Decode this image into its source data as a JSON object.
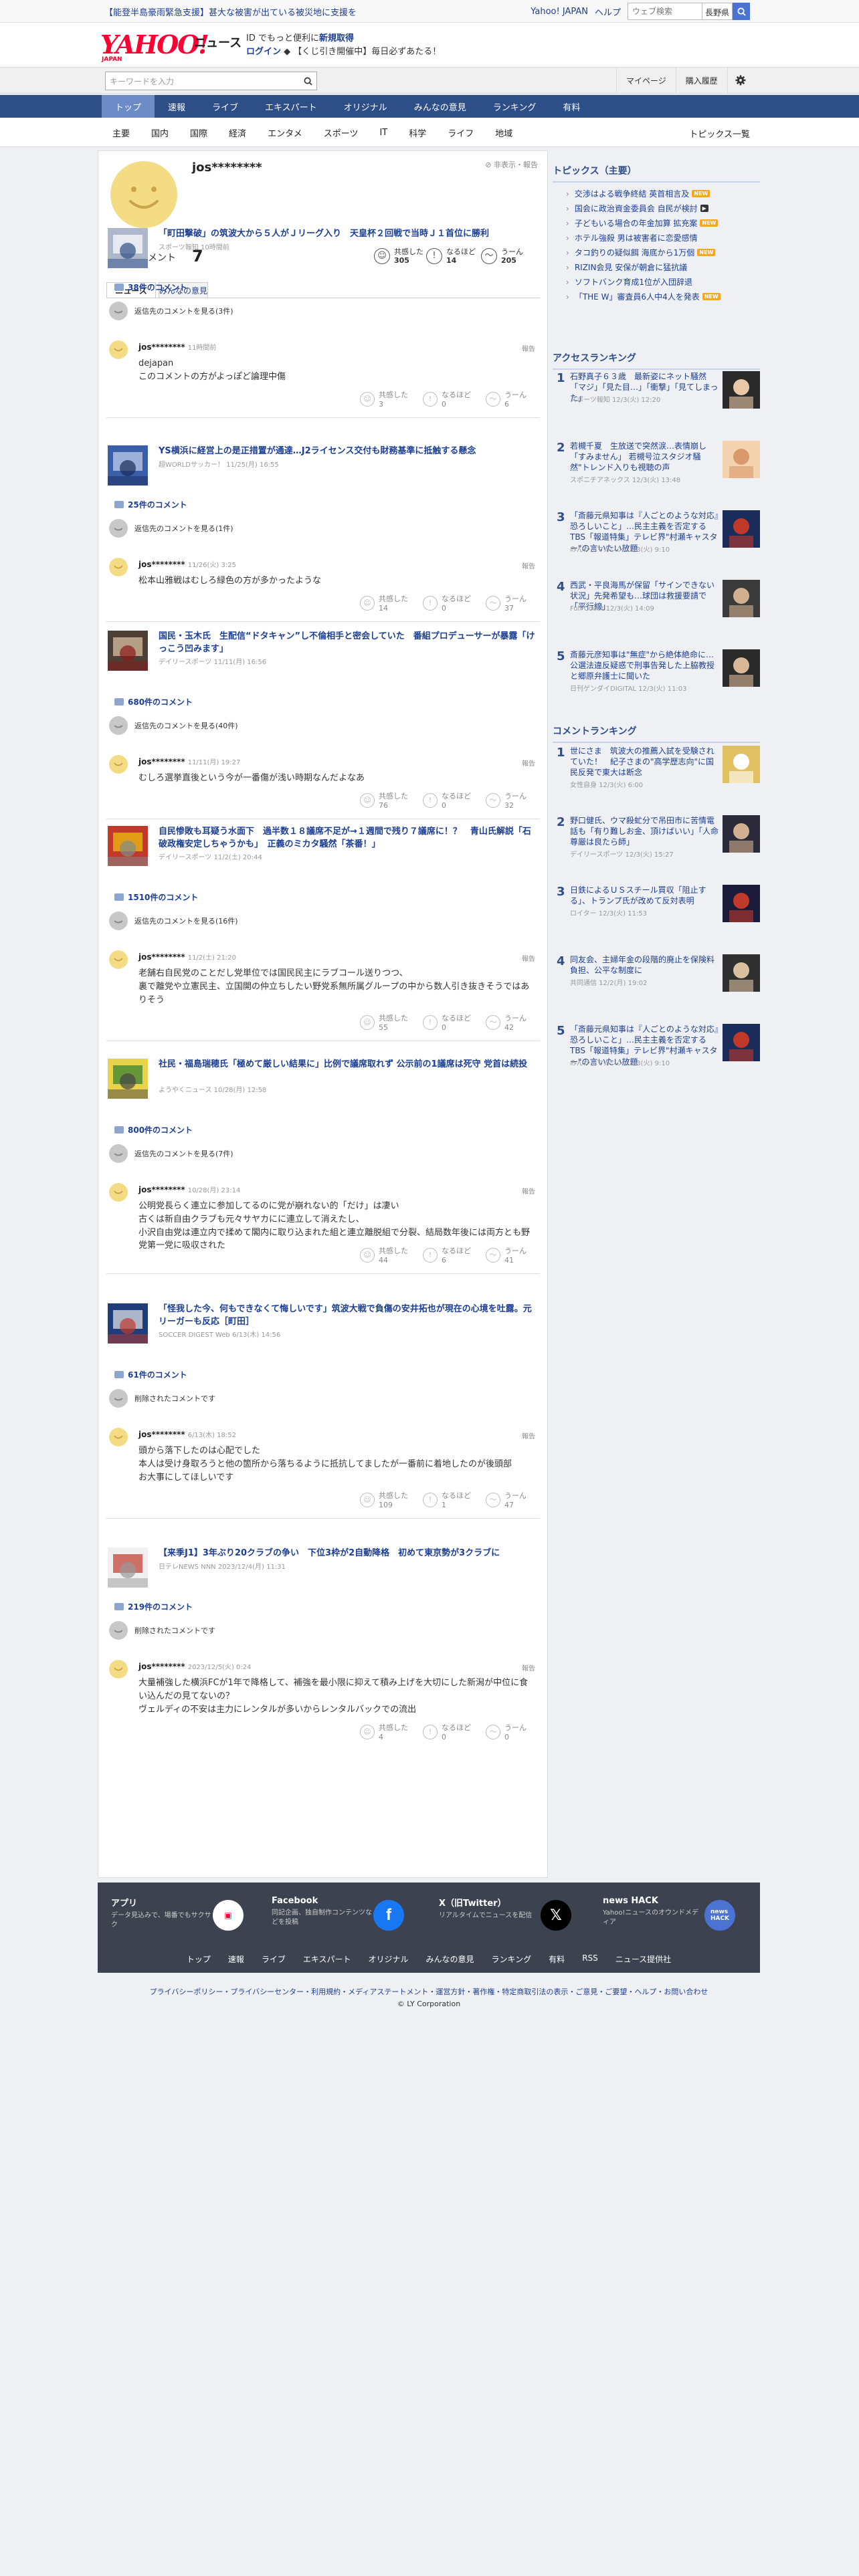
{
  "alert_bar": {
    "text": "【能登半島豪雨緊急支援】甚大な被害が出ている被災地に支援を",
    "yahoo_japan": "Yahoo! JAPAN",
    "help": "ヘルプ",
    "search_placeholder": "ウェブ検索",
    "location": "長野県"
  },
  "header": {
    "logo": "YAHOO!",
    "logo_sub": "JAPAN",
    "news": "ニュース",
    "msg_line1_pre": "ID でもっと便利に",
    "msg_line1_link": "新規取得",
    "msg_line2_login": "ログイン",
    "msg_line2_text": "【くじ引き開催中】毎日必ずあたる！"
  },
  "search": {
    "placeholder": "キーワードを入力",
    "mypage": "マイページ",
    "purchase": "購入履歴"
  },
  "global_nav": [
    "トップ",
    "速報",
    "ライブ",
    "エキスパート",
    "オリジナル",
    "みんなの意見",
    "ランキング",
    "有料"
  ],
  "sub_nav": [
    "主要",
    "国内",
    "国際",
    "経済",
    "エンタメ",
    "スポーツ",
    "IT",
    "科学",
    "ライフ",
    "地域"
  ],
  "topics_link": "トピックス一覧",
  "profile": {
    "name": "jos********",
    "report": "非表示・報告",
    "count_label": "投稿コメント",
    "count": "7",
    "reactions": [
      {
        "label": "共感した",
        "value": "305"
      },
      {
        "label": "なるほど",
        "value": "14"
      },
      {
        "label": "うーん",
        "value": "205"
      }
    ]
  },
  "tabs": [
    "ニュース",
    "みんなの意見"
  ],
  "entries": [
    {
      "title": "「町田撃破」の筑波大から５人がＪリーグ入り　天皇杯２回戦で当時Ｊ１首位に勝利",
      "meta": "スポーツ報知 10時間前",
      "count": "38件のコメント",
      "more": "返信先のコメントを見る(3件)",
      "user": "jos********",
      "time": "11時間前",
      "report": "報告",
      "text": "dejapan\nこのコメントの方がよっぽど論理中傷",
      "r": [
        "共感した",
        "3",
        "なるほど",
        "0",
        "うーん",
        "6"
      ]
    },
    {
      "title": "YS横浜に経営上の是正措置が通達…J2ライセンス交付も財務基準に抵触する懸念",
      "meta": "超WORLDサッカー！ 11/25(月) 16:55",
      "count": "25件のコメント",
      "more": "返信先のコメントを見る(1件)",
      "user": "jos********",
      "time": "11/26(火) 3:25",
      "report": "報告",
      "text": "松本山雅戦はむしろ緑色の方が多かったような",
      "r": [
        "共感した",
        "14",
        "なるほど",
        "0",
        "うーん",
        "37"
      ]
    },
    {
      "title": "国民・玉木氏　生配信“ドタキャン”し不倫相手と密会していた　番組プロデューサーが暴露「けっこう凹みます」",
      "meta": "デイリースポーツ 11/11(月) 16:56",
      "count": "680件のコメント",
      "more": "返信先のコメントを見る(40件)",
      "user": "jos********",
      "time": "11/11(月) 19:27",
      "report": "報告",
      "text": "むしろ選挙直後という今が一番傷が浅い時期なんだよなあ",
      "r": [
        "共感した",
        "76",
        "なるほど",
        "0",
        "うーん",
        "32"
      ]
    },
    {
      "title": "自民惨敗も耳疑う水面下　過半数１８議席不足が→１週間で残り７議席に！？　青山氏解説「石破政権安定しちゃうかも」　正義のミカタ騒然「茶番！」",
      "meta": "デイリースポーツ 11/2(土) 20:44",
      "count": "1510件のコメント",
      "more": "返信先のコメントを見る(16件)",
      "user": "jos********",
      "time": "11/2(土) 21:20",
      "report": "報告",
      "text": "老舗右自民党のことだし党単位では国民民主にラブコール送りつつ、\n裏で離党や立憲民主、立国開の仲立ちしたい野党系無所属グループの中から数人引き抜きそうではありそう",
      "r": [
        "共感した",
        "55",
        "なるほど",
        "0",
        "うーん",
        "42"
      ]
    },
    {
      "title": "社民・福島瑞穂氏「極めて厳しい結果に」比例で議席取れず 公示前の1議席は死守 党首は続投",
      "meta": "ようやくニュース 10/28(月) 12:58",
      "count": "800件のコメント",
      "more": "返信先のコメントを見る(7件)",
      "user": "jos********",
      "time": "10/28(月) 23:14",
      "report": "報告",
      "text": "公明党長らく連立に参加してるのに党が崩れない的「だけ」は凄い\n古くは新自由クラブも元々サヤカにに連立して消えたし、\n小沢自由党は連立内で揉めて閣内に取り込まれた組と連立離脱組で分裂、結局数年後には両方とも野党第一党に吸収された",
      "r": [
        "共感した",
        "44",
        "なるほど",
        "6",
        "うーん",
        "41"
      ]
    },
    {
      "title": "「怪我した今、何もできなくて悔しいです」筑波大戦で負傷の安井拓也が現在の心境を吐露。元リーガーも反応［町田］",
      "meta": "SOCCER DIGEST Web 6/13(木) 14:56",
      "count": "61件のコメント",
      "more": "削除されたコメントです",
      "user": "jos********",
      "time": "6/13(木) 18:52",
      "report": "報告",
      "text": "頭から落下したのは心配でした\n本人は受け身取ろうと他の箇所から落ちるように抵抗してましたが一番前に着地したのが後頭部\nお大事にしてほしいです",
      "r": [
        "共感した",
        "109",
        "なるほど",
        "1",
        "うーん",
        "47"
      ]
    },
    {
      "title": "【来季J1】3年ぶり20クラブの争い　下位3枠が2自動降格　初めて東京勢が3クラブに",
      "meta": "日テレNEWS NNN 2023/12/4(月) 11:31",
      "count": "219件のコメント",
      "more": "削除されたコメントです",
      "user": "jos********",
      "time": "2023/12/5(火) 0:24",
      "report": "報告",
      "text": "大量補強した横浜FCが1年で降格して、補強を最小限に抑えて積み上げを大切にした新潟が中位に食い込んだの見てないの？\nヴェルディの不安は主力にレンタルが多いからレンタルバックでの流出",
      "r": [
        "共感した",
        "4",
        "なるほど",
        "0",
        "うーん",
        "0"
      ]
    }
  ],
  "side": {
    "topics_title": "トピックス（主要）",
    "topics": [
      {
        "t": "交渉はよる戦争終結 英首相言及",
        "b": "NEW"
      },
      {
        "t": "国会に政治資金委員会 自民が検討",
        "b": "VIDEO"
      },
      {
        "t": "子どもいる場合の年金加算 拡充案",
        "b": "NEW"
      },
      {
        "t": "ホテル強殺 男は被害者に恋愛感情",
        "b": ""
      },
      {
        "t": "タコ釣りの疑似餌 海底から1万個",
        "b": "NEW"
      },
      {
        "t": "RIZIN会見 安保が朝倉に猛抗議",
        "b": ""
      },
      {
        "t": "ソフトバンク育成1位が入団辞退",
        "b": ""
      },
      {
        "t": "「THE W」審査員6人中4人を発表",
        "b": "NEW"
      }
    ],
    "access_title": "アクセスランキング",
    "access": [
      {
        "t": "石野真子６３歳　最新姿にネット騒然「マジ」「見た目…」「衝撃」「見てしまった」",
        "m": "スポーツ報知 12/3(火) 12:20"
      },
      {
        "t": "若槻千夏　生放送で突然涙…表情崩し「すみません」 若槻号泣スタジオ騒然\"トレンド入りも視聴の声",
        "m": "スポニチアネックス 12/3(火) 13:48"
      },
      {
        "t": "「斎藤元県知事は『人ごとのような対応』恐ろしいこと」…民主主義を否定するTBS「報道特集」テレビ界\"村瀬キャスター\"の言いたい放題",
        "m": "みんかぶマガジン 12/3(火) 9:10"
      },
      {
        "t": "西武・平良海馬が保留「サインできない状況」先発希望も…球団は救援要請で「平行線」",
        "m": "Full-Count 12/3(火) 14:09"
      },
      {
        "t": "斎藤元彦知事は\"無症\"から絶体絶命に…公選法違反疑惑で刑事告発した上脇教授と郷原弁護士に聞いた",
        "m": "日刊ゲンダイDIGITAL 12/3(火) 11:03"
      }
    ],
    "comment_title": "コメントランキング",
    "comment": [
      {
        "t": "世にさま　筑波大の推薦入試を受験されていた！　紀子さまの\"高学歴志向\"に国民反発で東大は断念",
        "m": "女性自身 12/3(火) 6:00"
      },
      {
        "t": "野口健氏、ウマ殺虻分で吊田市に苦情電話も「有り難しお金、頂けばいい」「人命尊厳は良たら師」",
        "m": "デイリースポーツ 12/3(火) 15:27"
      },
      {
        "t": "日鉄によるＵＳスチール買収「阻止する」、トランプ氏が改めて反対表明",
        "m": "ロイター 12/3(火) 11:53"
      },
      {
        "t": "同友会、主婦年金の段階的廃止を保険料負担、公平な制度に",
        "m": "共同通信 12/2(月) 19:02"
      },
      {
        "t": "「斎藤元県知事は『人ごとのような対応』恐ろしいこと」…民主主義を否定するTBS「報道特集」テレビ界\"村瀬キャスター\"の言いたい放題",
        "m": "みんかぶマガジン 12/3(火) 9:10"
      }
    ]
  },
  "footer": {
    "cards": [
      {
        "title": "アプリ",
        "desc": "データ見込みで、場番でもサクサク"
      },
      {
        "title": "Facebook",
        "desc": "同記企画、独自制作コンテンツなどを投稿"
      },
      {
        "title": "X（旧Twitter）",
        "desc": "リアルタイムでニュースを配信"
      },
      {
        "title": "news HACK",
        "desc": "Yahoo!ニュースのオウンドメディア"
      }
    ],
    "nav": [
      "トップ",
      "速報",
      "ライブ",
      "エキスパート",
      "オリジナル",
      "みんなの意見",
      "ランキング",
      "有料",
      "RSS",
      "ニュース提供社"
    ],
    "sub": "プライバシーポリシー・プライバシーセンター・利用規約・メディアステートメント・運営方針・著作権・特定商取引法の表示・ご意見・ご要望・ヘルプ・お問い合わせ",
    "copy": "© LY Corporation"
  }
}
